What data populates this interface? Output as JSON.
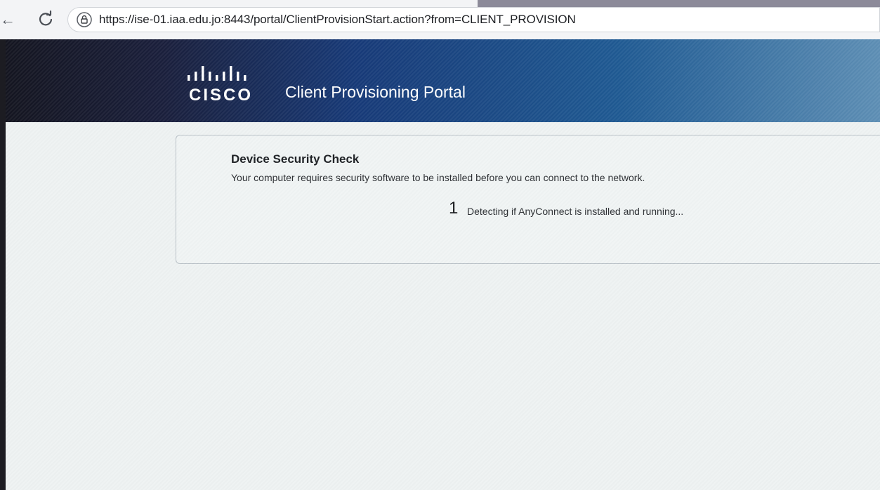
{
  "browser": {
    "url": "https://ise-01.iaa.edu.jo:8443/portal/ClientProvisionStart.action?from=CLIENT_PROVISION",
    "icons": {
      "back": "back-arrow-icon",
      "reload": "reload-icon",
      "site_info": "lock-icon"
    }
  },
  "header": {
    "logo_text": "CISCO",
    "portal_title": "Client Provisioning Portal",
    "brand_color": "#173a78"
  },
  "card": {
    "heading": "Device Security Check",
    "message": "Your computer requires security software to be installed before you can connect to the network.",
    "step": {
      "number": "1",
      "text": "Detecting if AnyConnect is installed and running..."
    }
  }
}
